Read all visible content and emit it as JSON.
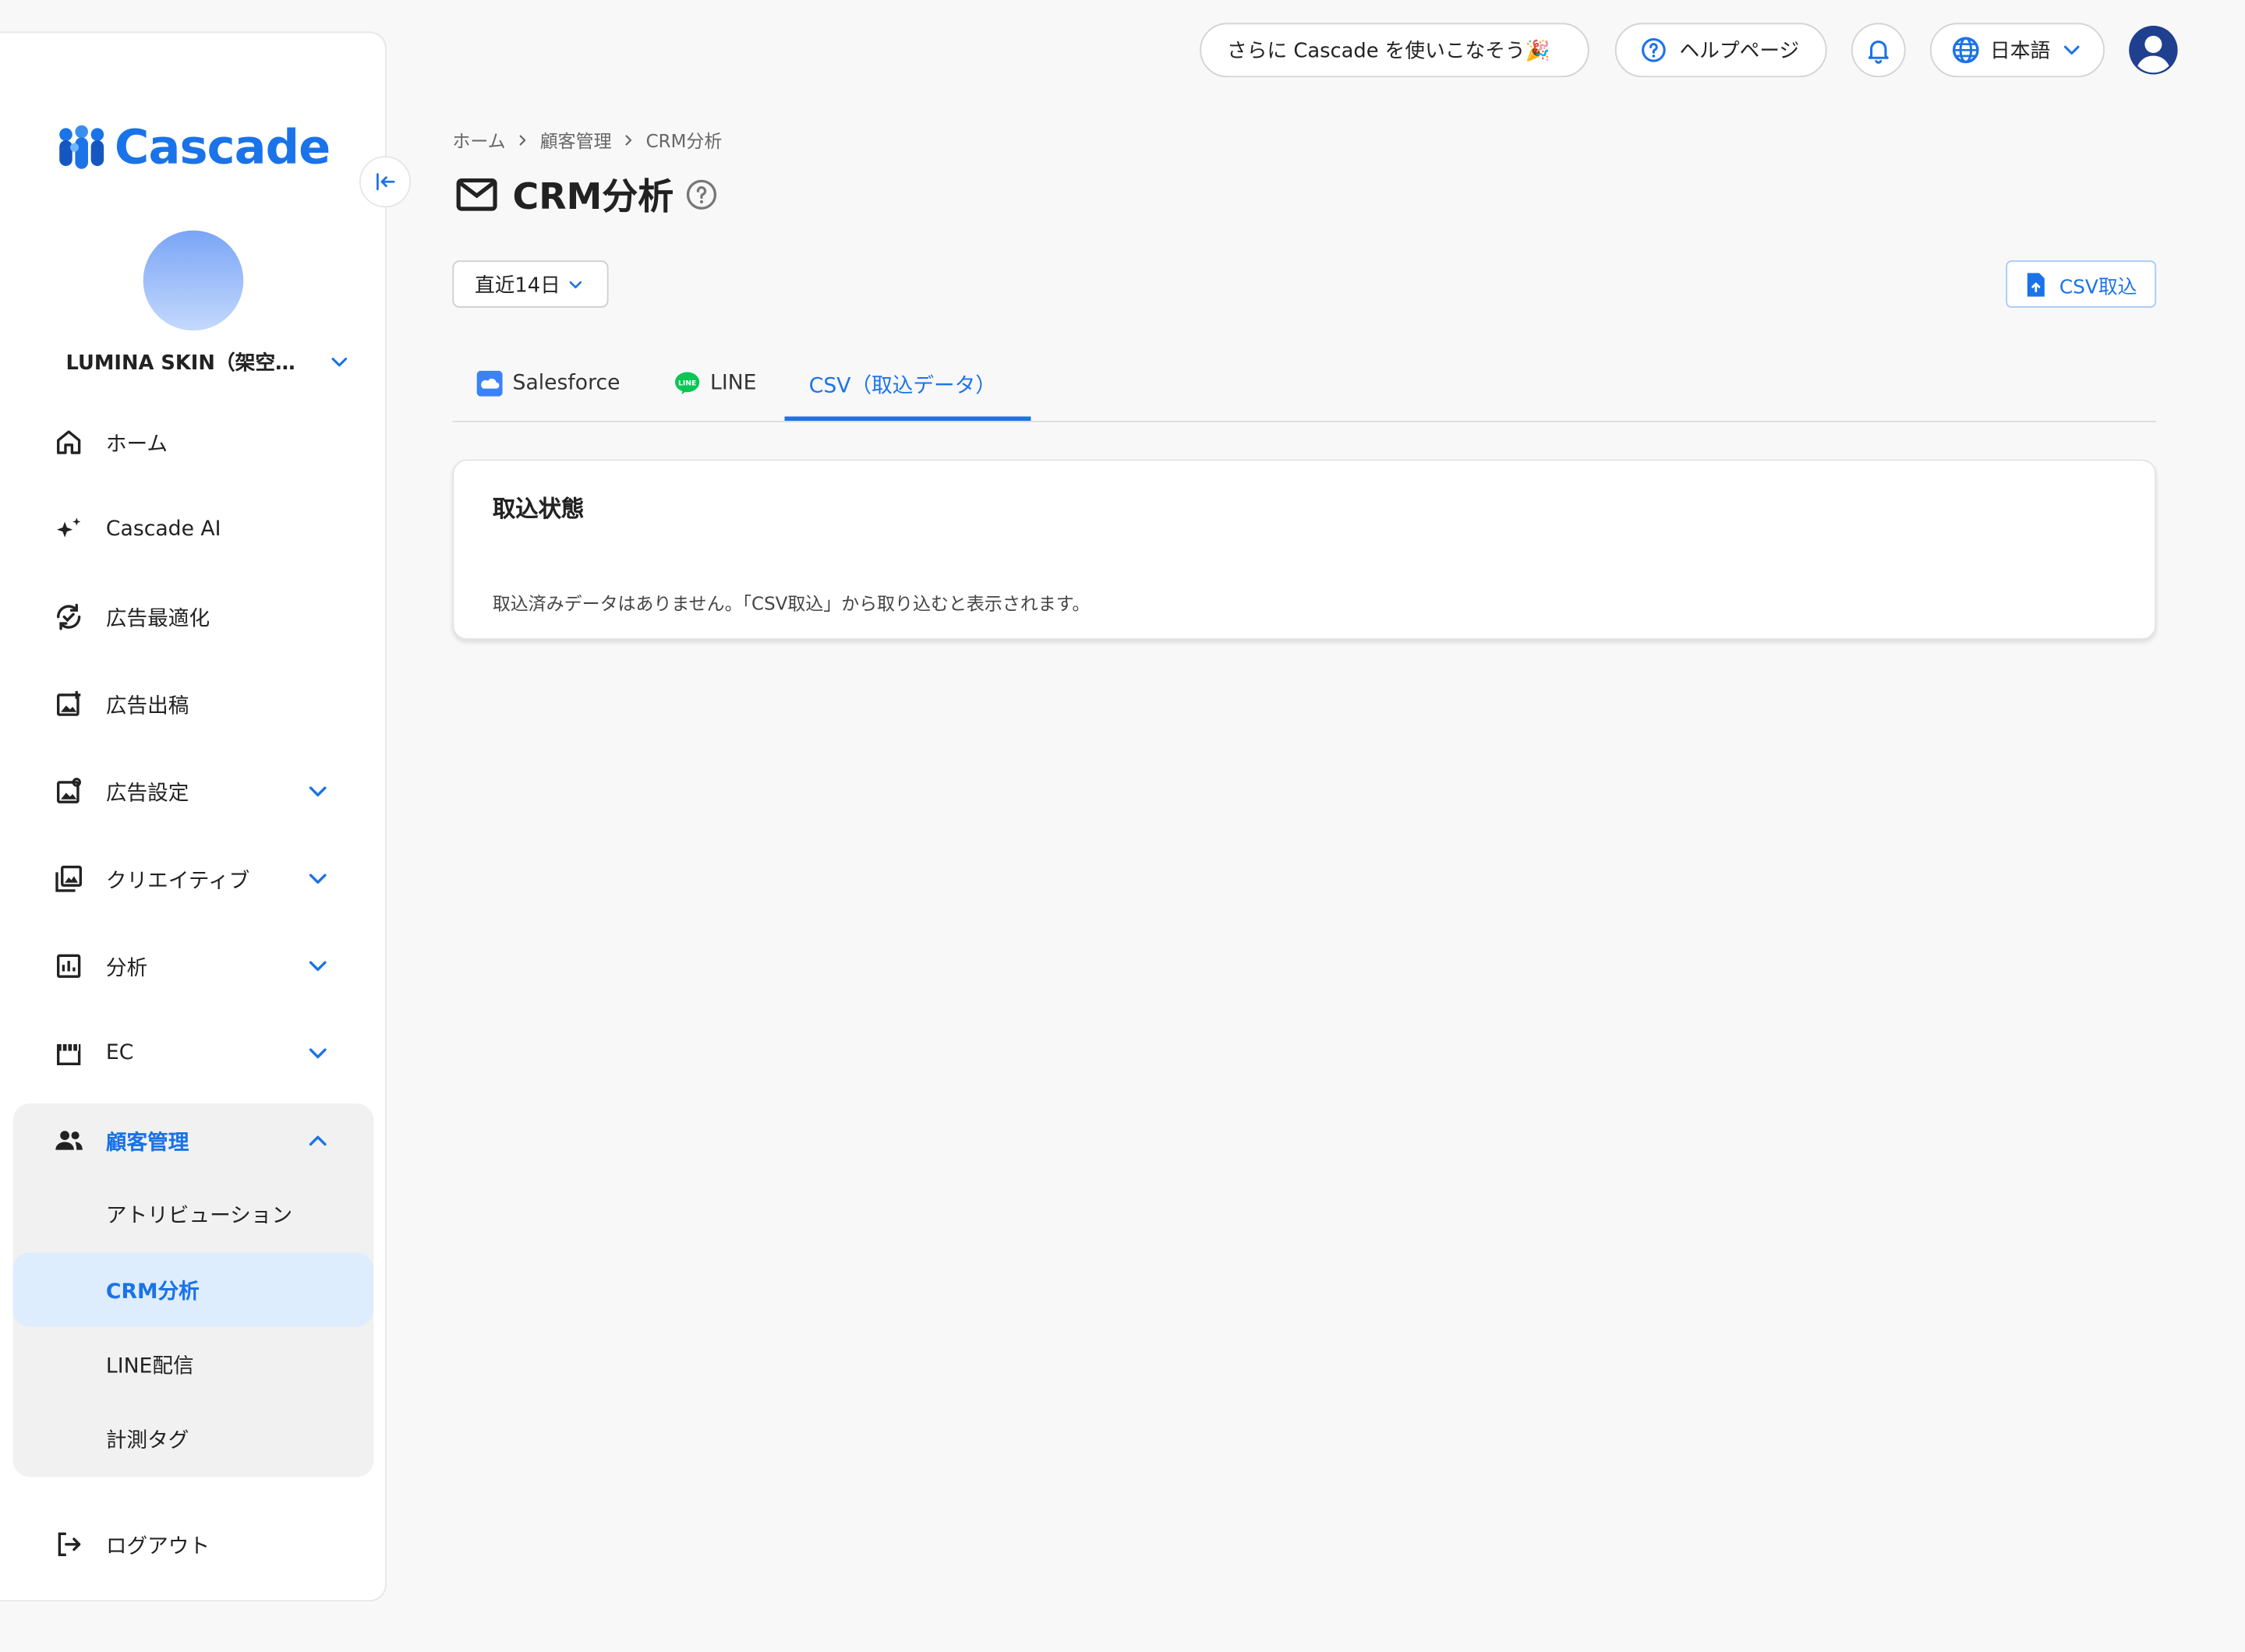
{
  "app": {
    "name": "Cascade",
    "brand_color": "#1a73e8",
    "account_name": "LUMINA SKIN（架空…"
  },
  "topbar": {
    "promo_label": "さらに Cascade を使いこなそう🎉",
    "help_label": "ヘルプページ",
    "language_label": "日本語"
  },
  "sidebar": {
    "items": [
      {
        "label": "ホーム",
        "icon": "home-icon"
      },
      {
        "label": "Cascade AI",
        "icon": "sparkle-icon"
      },
      {
        "label": "広告最適化",
        "icon": "cycle-check-icon"
      },
      {
        "label": "広告出稿",
        "icon": "image-add-icon"
      },
      {
        "label": "広告設定",
        "icon": "image-settings-icon"
      },
      {
        "label": "クリエイティブ",
        "icon": "image-library-icon"
      },
      {
        "label": "分析",
        "icon": "chart-icon"
      },
      {
        "label": "EC",
        "icon": "store-icon"
      },
      {
        "label": "顧客管理",
        "icon": "people-icon"
      }
    ],
    "sub_items": [
      {
        "label": "アトリビューション"
      },
      {
        "label": "CRM分析"
      },
      {
        "label": "LINE配信"
      },
      {
        "label": "計測タグ"
      }
    ],
    "logout_label": "ログアウト"
  },
  "main": {
    "breadcrumb": [
      "ホーム",
      "顧客管理",
      "CRM分析"
    ],
    "title": "CRM分析",
    "range_label": "直近14日",
    "csv_button_label": "CSV取込",
    "tabs": [
      {
        "label": "Salesforce",
        "icon": "salesforce-icon"
      },
      {
        "label": "LINE",
        "icon": "line-icon"
      },
      {
        "label": "CSV（取込データ）",
        "active": true
      }
    ],
    "card": {
      "title": "取込状態",
      "message": "取込済みデータはありません。「CSV取込」から取り込むと表示されます。"
    }
  }
}
